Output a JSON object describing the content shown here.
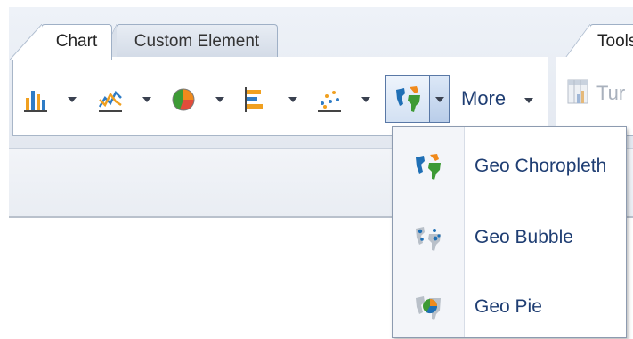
{
  "tabs": [
    {
      "label": "Chart"
    },
    {
      "label": "Custom Element"
    },
    {
      "label": "Tools"
    }
  ],
  "toolbar": {
    "buttons": [
      {
        "icon": "bar-chart-icon"
      },
      {
        "icon": "line-chart-icon"
      },
      {
        "icon": "pie-chart-icon"
      },
      {
        "icon": "horizontal-bar-chart-icon"
      },
      {
        "icon": "scatter-chart-icon"
      },
      {
        "icon": "geo-map-icon"
      }
    ],
    "more_label": "More",
    "turn_label": "Tur"
  },
  "geo_menu": {
    "items": [
      {
        "label": "Geo Choropleth",
        "icon": "geo-choropleth-icon"
      },
      {
        "label": "Geo Bubble",
        "icon": "geo-bubble-icon"
      },
      {
        "label": "Geo Pie",
        "icon": "geo-pie-icon"
      }
    ]
  },
  "colors": {
    "accent_text": "#1f3e73",
    "map_blue": "#1f6fb5",
    "map_green": "#3d9a35",
    "map_orange": "#f08a1c"
  }
}
